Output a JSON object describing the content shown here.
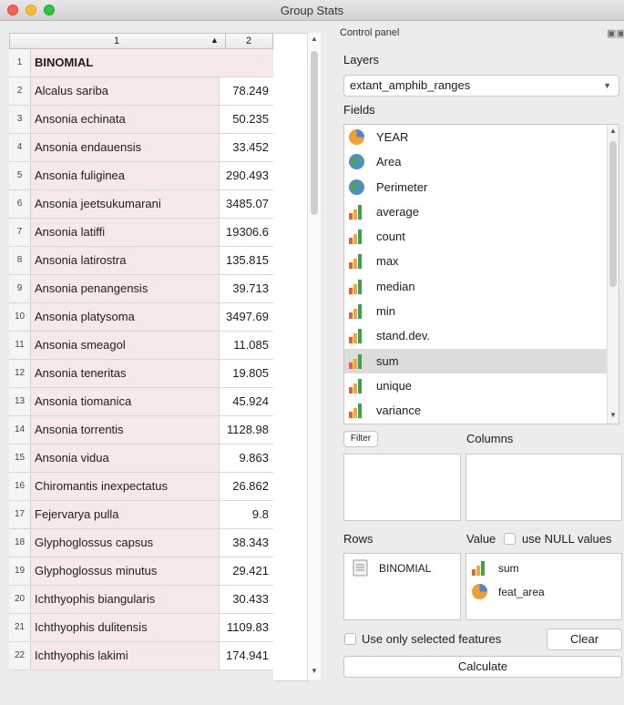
{
  "window": {
    "title": "Group Stats"
  },
  "table": {
    "col1_header": "1",
    "col2_header": "2",
    "rows": [
      {
        "num": "1",
        "name": "BINOMIAL",
        "value": ""
      },
      {
        "num": "2",
        "name": "Alcalus sariba",
        "value": "78.249"
      },
      {
        "num": "3",
        "name": "Ansonia echinata",
        "value": "50.235"
      },
      {
        "num": "4",
        "name": "Ansonia endauensis",
        "value": "33.452"
      },
      {
        "num": "5",
        "name": "Ansonia fuliginea",
        "value": "290.493"
      },
      {
        "num": "6",
        "name": "Ansonia jeetsukumarani",
        "value": "3485.07"
      },
      {
        "num": "7",
        "name": "Ansonia latiffi",
        "value": "19306.6"
      },
      {
        "num": "8",
        "name": "Ansonia latirostra",
        "value": "135.815"
      },
      {
        "num": "9",
        "name": "Ansonia penangensis",
        "value": "39.713"
      },
      {
        "num": "10",
        "name": "Ansonia platysoma",
        "value": "3497.69"
      },
      {
        "num": "11",
        "name": "Ansonia smeagol",
        "value": "11.085"
      },
      {
        "num": "12",
        "name": "Ansonia teneritas",
        "value": "19.805"
      },
      {
        "num": "13",
        "name": "Ansonia tiomanica",
        "value": "45.924"
      },
      {
        "num": "14",
        "name": "Ansonia torrentis",
        "value": "1128.98"
      },
      {
        "num": "15",
        "name": "Ansonia vidua",
        "value": "9.863"
      },
      {
        "num": "16",
        "name": "Chiromantis inexpectatus",
        "value": "26.862"
      },
      {
        "num": "17",
        "name": "Fejervarya pulla",
        "value": "9.8"
      },
      {
        "num": "18",
        "name": "Glyphoglossus capsus",
        "value": "38.343"
      },
      {
        "num": "19",
        "name": "Glyphoglossus minutus",
        "value": "29.421"
      },
      {
        "num": "20",
        "name": "Ichthyophis biangularis",
        "value": "30.433"
      },
      {
        "num": "21",
        "name": "Ichthyophis dulitensis",
        "value": "1109.83"
      },
      {
        "num": "22",
        "name": "Ichthyophis lakimi",
        "value": "174.941"
      }
    ]
  },
  "control_panel": {
    "title": "Control panel",
    "layers_label": "Layers",
    "layer_selected": "extant_amphib_ranges",
    "fields_label": "Fields",
    "fields": [
      {
        "label": "YEAR",
        "icon": "pie-icon"
      },
      {
        "label": "Area",
        "icon": "globe-icon"
      },
      {
        "label": "Perimeter",
        "icon": "globe-icon"
      },
      {
        "label": "average",
        "icon": "bar-chart-icon"
      },
      {
        "label": "count",
        "icon": "bar-chart-icon"
      },
      {
        "label": "max",
        "icon": "bar-chart-icon"
      },
      {
        "label": "median",
        "icon": "bar-chart-icon"
      },
      {
        "label": "min",
        "icon": "bar-chart-icon"
      },
      {
        "label": "stand.dev.",
        "icon": "bar-chart-icon"
      },
      {
        "label": "sum",
        "icon": "bar-chart-icon",
        "selected": true
      },
      {
        "label": "unique",
        "icon": "bar-chart-icon"
      },
      {
        "label": "variance",
        "icon": "bar-chart-icon"
      }
    ],
    "filter_label": "Filter",
    "columns_label": "Columns",
    "rows_label": "Rows",
    "value_label": "Value",
    "use_null_label": "use NULL values",
    "rows_items": [
      {
        "label": "BINOMIAL",
        "icon": "document-icon"
      }
    ],
    "value_items": [
      {
        "label": "sum",
        "icon": "bar-chart-icon"
      },
      {
        "label": "feat_area",
        "icon": "pie-icon"
      }
    ],
    "use_selected_label": "Use only selected features",
    "clear_label": "Clear",
    "calculate_label": "Calculate"
  },
  "colors": {
    "row_highlight": "#f7e9e9",
    "selection": "#dcdcdc"
  }
}
